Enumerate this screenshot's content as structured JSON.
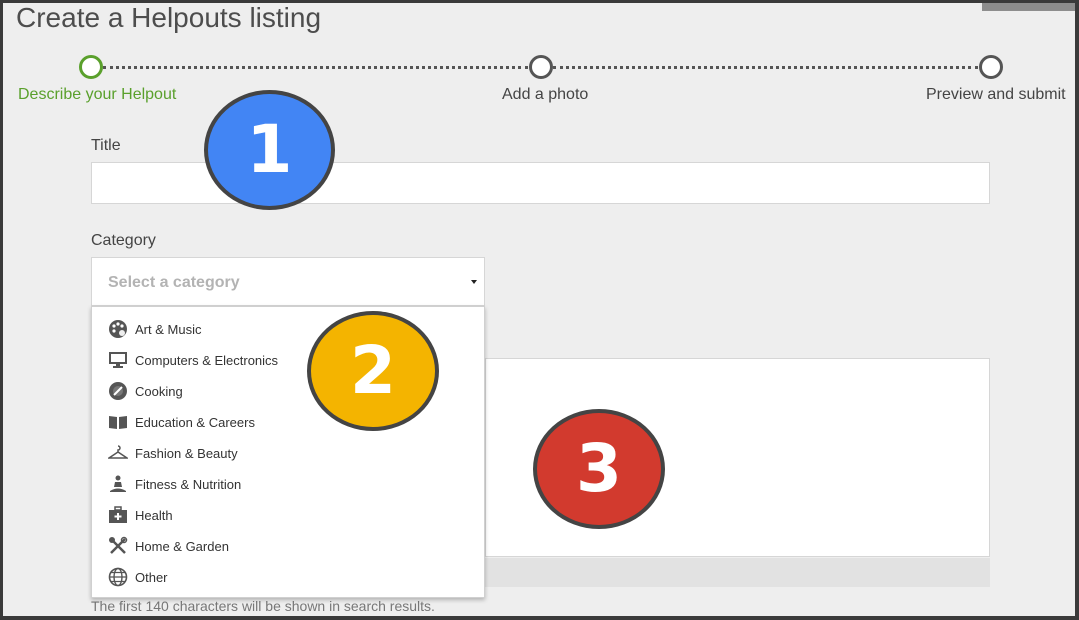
{
  "header": {
    "title": "Create a Helpouts listing"
  },
  "stepper": {
    "steps": [
      {
        "label": "Describe your Helpout",
        "active": true
      },
      {
        "label": "Add a photo",
        "active": false
      },
      {
        "label": "Preview and submit",
        "active": false
      }
    ],
    "active_color": "#5aa02c"
  },
  "form": {
    "title_label": "Title",
    "title_value": "",
    "category_label": "Category",
    "category_placeholder": "Select a category",
    "hint": "The first 140 characters will be shown in search results."
  },
  "dropdown": {
    "items": [
      {
        "label": "Art & Music",
        "icon": "palette-icon"
      },
      {
        "label": "Computers & Electronics",
        "icon": "monitor-icon"
      },
      {
        "label": "Cooking",
        "icon": "cooking-icon"
      },
      {
        "label": "Education & Careers",
        "icon": "book-icon"
      },
      {
        "label": "Fashion & Beauty",
        "icon": "hanger-icon"
      },
      {
        "label": "Fitness & Nutrition",
        "icon": "meditation-icon"
      },
      {
        "label": "Health",
        "icon": "first-aid-icon"
      },
      {
        "label": "Home & Garden",
        "icon": "tools-icon"
      },
      {
        "label": "Other",
        "icon": "globe-icon"
      }
    ]
  },
  "annotations": [
    {
      "number": "1",
      "color": "#4285f4"
    },
    {
      "number": "2",
      "color": "#f4b400"
    },
    {
      "number": "3",
      "color": "#d23a2e"
    }
  ]
}
